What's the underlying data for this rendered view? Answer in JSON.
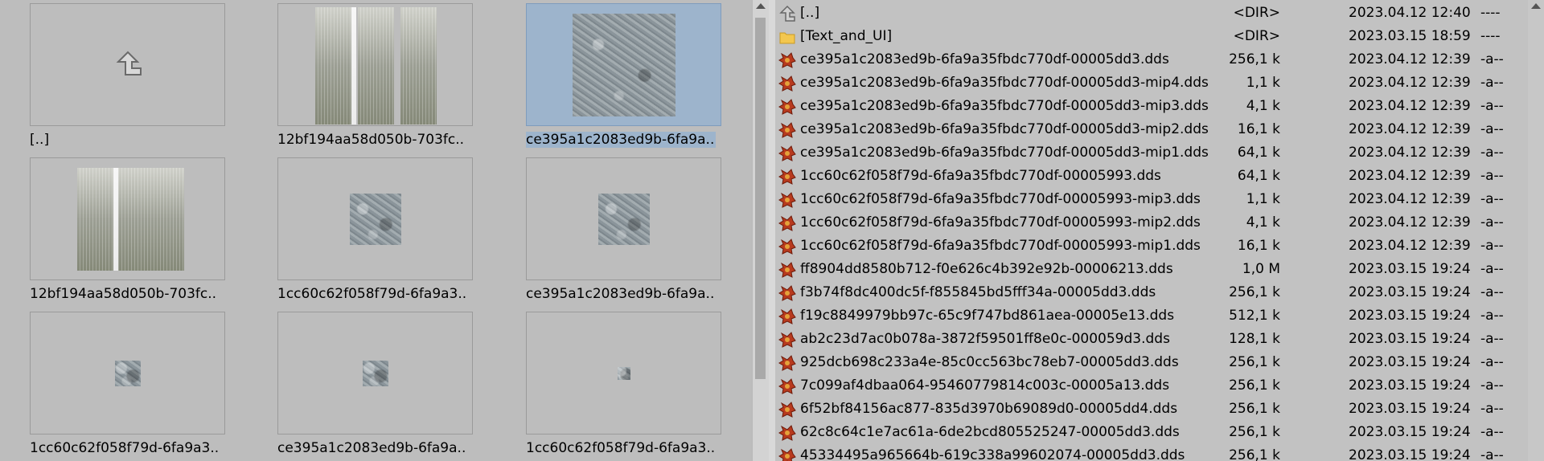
{
  "thumbnails": [
    {
      "label": "[..]",
      "type": "parent"
    },
    {
      "label": "12bf194aa58d050b-703fc..",
      "type": "grass"
    },
    {
      "label": "ce395a1c2083ed9b-6fa9a..",
      "type": "texture-large",
      "selected": true
    },
    {
      "label": "12bf194aa58d050b-703fc..",
      "type": "grass"
    },
    {
      "label": "1cc60c62f058f79d-6fa9a3..",
      "type": "texture-medium"
    },
    {
      "label": "ce395a1c2083ed9b-6fa9a..",
      "type": "texture-medium"
    },
    {
      "label": "1cc60c62f058f79d-6fa9a3..",
      "type": "texture-small"
    },
    {
      "label": "ce395a1c2083ed9b-6fa9a..",
      "type": "texture-small"
    },
    {
      "label": "1cc60c62f058f79d-6fa9a3..",
      "type": "texture-tiny"
    }
  ],
  "files": [
    {
      "name": "[..]",
      "size": "<DIR>",
      "date": "2023.04.12 12:40",
      "attr": "----",
      "icon": "up-dir-icon"
    },
    {
      "name": "[Text_and_UI]",
      "size": "<DIR>",
      "date": "2023.03.15 18:59",
      "attr": "----",
      "icon": "folder-icon"
    },
    {
      "name": "ce395a1c2083ed9b-6fa9a35fbdc770df-00005dd3.dds",
      "size": "256,1 k",
      "date": "2023.04.12 12:39",
      "attr": "-a--",
      "icon": "dds-file-icon"
    },
    {
      "name": "ce395a1c2083ed9b-6fa9a35fbdc770df-00005dd3-mip4.dds",
      "size": "1,1 k",
      "date": "2023.04.12 12:39",
      "attr": "-a--",
      "icon": "dds-file-icon"
    },
    {
      "name": "ce395a1c2083ed9b-6fa9a35fbdc770df-00005dd3-mip3.dds",
      "size": "4,1 k",
      "date": "2023.04.12 12:39",
      "attr": "-a--",
      "icon": "dds-file-icon"
    },
    {
      "name": "ce395a1c2083ed9b-6fa9a35fbdc770df-00005dd3-mip2.dds",
      "size": "16,1 k",
      "date": "2023.04.12 12:39",
      "attr": "-a--",
      "icon": "dds-file-icon"
    },
    {
      "name": "ce395a1c2083ed9b-6fa9a35fbdc770df-00005dd3-mip1.dds",
      "size": "64,1 k",
      "date": "2023.04.12 12:39",
      "attr": "-a--",
      "icon": "dds-file-icon"
    },
    {
      "name": "1cc60c62f058f79d-6fa9a35fbdc770df-00005993.dds",
      "size": "64,1 k",
      "date": "2023.04.12 12:39",
      "attr": "-a--",
      "icon": "dds-file-icon"
    },
    {
      "name": "1cc60c62f058f79d-6fa9a35fbdc770df-00005993-mip3.dds",
      "size": "1,1 k",
      "date": "2023.04.12 12:39",
      "attr": "-a--",
      "icon": "dds-file-icon"
    },
    {
      "name": "1cc60c62f058f79d-6fa9a35fbdc770df-00005993-mip2.dds",
      "size": "4,1 k",
      "date": "2023.04.12 12:39",
      "attr": "-a--",
      "icon": "dds-file-icon"
    },
    {
      "name": "1cc60c62f058f79d-6fa9a35fbdc770df-00005993-mip1.dds",
      "size": "16,1 k",
      "date": "2023.04.12 12:39",
      "attr": "-a--",
      "icon": "dds-file-icon"
    },
    {
      "name": "ff8904dd8580b712-f0e626c4b392e92b-00006213.dds",
      "size": "1,0 M",
      "date": "2023.03.15 19:24",
      "attr": "-a--",
      "icon": "dds-file-icon"
    },
    {
      "name": "f3b74f8dc400dc5f-f855845bd5fff34a-00005dd3.dds",
      "size": "256,1 k",
      "date": "2023.03.15 19:24",
      "attr": "-a--",
      "icon": "dds-file-icon"
    },
    {
      "name": "f19c8849979bb97c-65c9f747bd861aea-00005e13.dds",
      "size": "512,1 k",
      "date": "2023.03.15 19:24",
      "attr": "-a--",
      "icon": "dds-file-icon"
    },
    {
      "name": "ab2c23d7ac0b078a-3872f59501ff8e0c-000059d3.dds",
      "size": "128,1 k",
      "date": "2023.03.15 19:24",
      "attr": "-a--",
      "icon": "dds-file-icon"
    },
    {
      "name": "925dcb698c233a4e-85c0cc563bc78eb7-00005dd3.dds",
      "size": "256,1 k",
      "date": "2023.03.15 19:24",
      "attr": "-a--",
      "icon": "dds-file-icon"
    },
    {
      "name": "7c099af4dbaa064-95460779814c003c-00005a13.dds",
      "size": "256,1 k",
      "date": "2023.03.15 19:24",
      "attr": "-a--",
      "icon": "dds-file-icon"
    },
    {
      "name": "6f52bf84156ac877-835d3970b69089d0-00005dd4.dds",
      "size": "256,1 k",
      "date": "2023.03.15 19:24",
      "attr": "-a--",
      "icon": "dds-file-icon"
    },
    {
      "name": "62c8c64c1e7ac61a-6de2bcd805525247-00005dd3.dds",
      "size": "256,1 k",
      "date": "2023.03.15 19:24",
      "attr": "-a--",
      "icon": "dds-file-icon"
    },
    {
      "name": "45334495a965664b-619c338a99602074-00005dd3.dds",
      "size": "256,1 k",
      "date": "2023.03.15 19:24",
      "attr": "-a--",
      "icon": "dds-file-icon"
    }
  ],
  "colors": {
    "selection": "#9db4cc",
    "pane_bg": "#bdbdbd",
    "dds_icon": "#b83a1e"
  }
}
